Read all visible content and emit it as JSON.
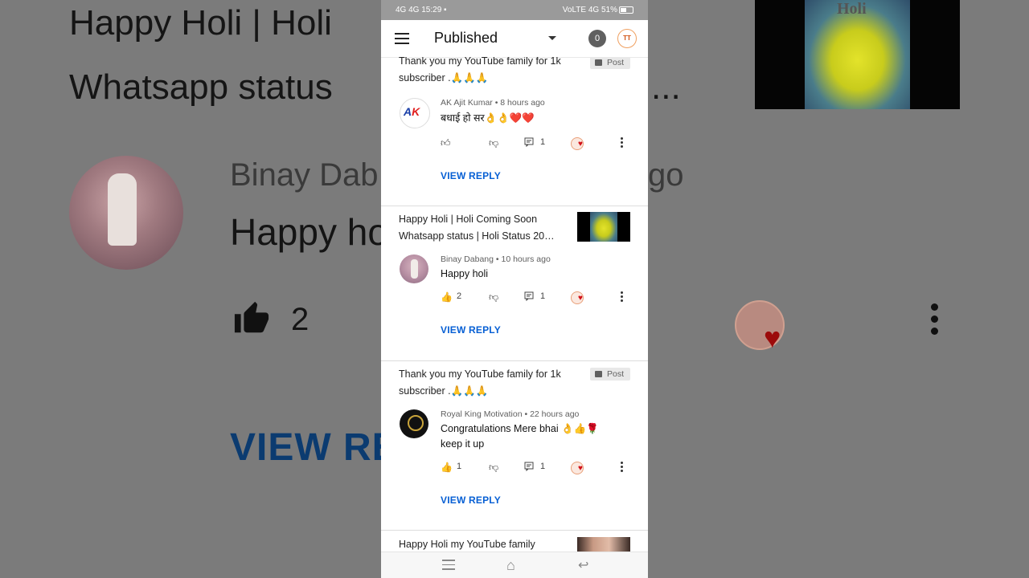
{
  "background": {
    "title_line1": "Happy Holi  | Holi",
    "title_line2": "Whatsapp status",
    "title_ellipsis": "...",
    "thumb_text": "Holi",
    "commenter_name_left": "Binay Dab",
    "commenter_name_right": "go",
    "comment_text": "Happy ho",
    "like_count": "2",
    "view_reply": "VIEW RE"
  },
  "statusbar": {
    "left": "4G 4G 15:29 ▪",
    "right": "VoLTE 4G 51%"
  },
  "appbar": {
    "title": "Published",
    "notification_count": "0",
    "channel_avatar_text": "TT"
  },
  "cards": [
    {
      "video_title": "Thank you my YouTube family for 1k subscriber .🙏🙏🙏",
      "post_label": "Post",
      "author": "AK Ajit Kumar",
      "time": "8 hours ago",
      "comment": "बधाई हो सर👌👌❤️❤️",
      "like_count": "",
      "reply_count": "1",
      "view_reply": "VIEW REPLY"
    },
    {
      "video_title": "Happy Holi  | Holi Coming Soon Whatsapp status | Holi Status 20…",
      "author": "Binay Dabang",
      "time": "10 hours ago",
      "comment": "Happy holi",
      "like_count": "2",
      "reply_count": "1",
      "view_reply": "VIEW REPLY"
    },
    {
      "video_title": "Thank you my YouTube family for 1k subscriber .🙏🙏🙏",
      "post_label": "Post",
      "author": "Royal King Motivation",
      "time": "22 hours ago",
      "comment": "Congratulations Mere bhai 👌👍🌹 keep it up",
      "like_count": "1",
      "reply_count": "1",
      "view_reply": "VIEW REPLY"
    },
    {
      "video_title": "Happy Holi my YouTube family"
    }
  ],
  "separator": " • ",
  "icons": [
    "menu-icon",
    "caret-down-icon",
    "thumb-up-icon",
    "thumb-down-icon",
    "reply-icon",
    "heart-icon",
    "more-icon",
    "image-icon",
    "recents-icon",
    "home-icon",
    "back-icon"
  ]
}
